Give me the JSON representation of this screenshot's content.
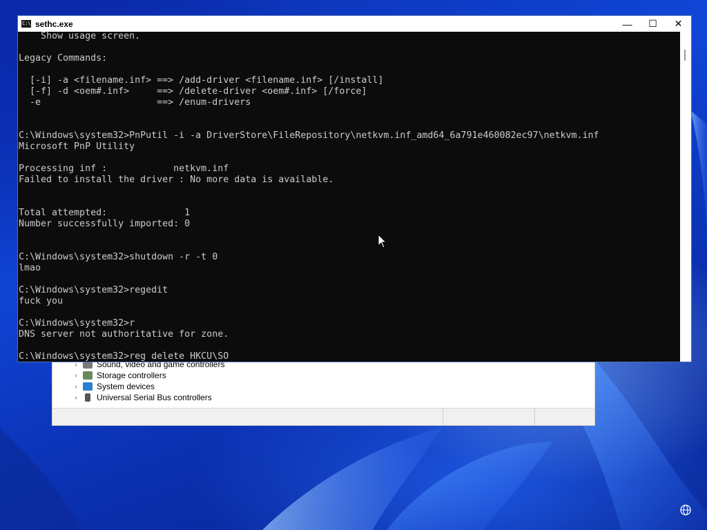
{
  "console_window": {
    "title": "sethc.exe",
    "icon": "console-icon",
    "icon_text": "C:\\",
    "controls": {
      "minimize": "—",
      "maximize": "☐",
      "close": "✕"
    },
    "lines": [
      "    Show usage screen.",
      "",
      "Legacy Commands:",
      "",
      "  [-i] -a <filename.inf> ==> /add-driver <filename.inf> [/install]",
      "  [-f] -d <oem#.inf>     ==> /delete-driver <oem#.inf> [/force]",
      "  -e                     ==> /enum-drivers",
      "",
      "",
      "C:\\Windows\\system32>PnPutil -i -a DriverStore\\FileRepository\\netkvm.inf_amd64_6a791e460082ec97\\netkvm.inf",
      "Microsoft PnP Utility",
      "",
      "Processing inf :            netkvm.inf",
      "Failed to install the driver : No more data is available.",
      "",
      "",
      "Total attempted:              1",
      "Number successfully imported: 0",
      "",
      "",
      "C:\\Windows\\system32>shutdown -r -t 0",
      "lmao",
      "",
      "C:\\Windows\\system32>regedit",
      "fuck you",
      "",
      "C:\\Windows\\system32>r",
      "DNS server not authoritative for zone.",
      "",
      "C:\\Windows\\system32>reg delete HKCU\\SO"
    ]
  },
  "device_manager": {
    "items": [
      {
        "label": "Sound, video and game controllers",
        "icon": "speaker-icon"
      },
      {
        "label": "Storage controllers",
        "icon": "storage-controller-icon"
      },
      {
        "label": "System devices",
        "icon": "system-devices-icon"
      },
      {
        "label": "Universal Serial Bus controllers",
        "icon": "usb-icon"
      }
    ]
  },
  "colors": {
    "console_bg": "#0c0c0c",
    "console_text": "#cccccc",
    "desktop_bg": "#0b2ba8"
  },
  "tray": {
    "icon": "language-globe-icon"
  }
}
